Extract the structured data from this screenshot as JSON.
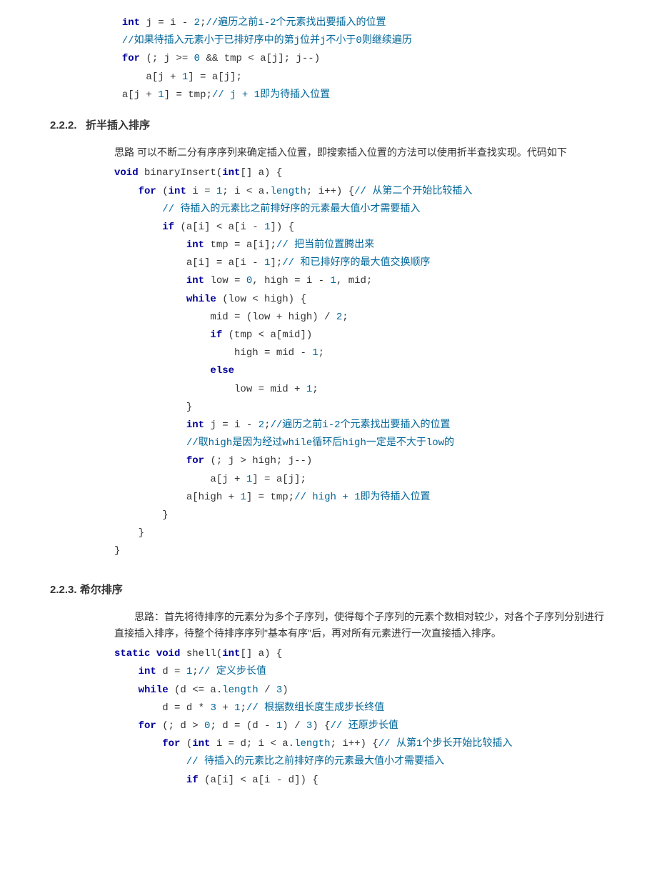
{
  "code_top": {
    "l1": {
      "a": "int",
      "b": " j = i - ",
      "c": "2",
      "d": ";",
      "e": "//遍历之前i-2个元素找出要插入的位置"
    },
    "l2": {
      "a": "//如果待插入元素小于已排好序中的第j位并j不小于0则继续遍历"
    },
    "l3": {
      "a": "for",
      "b": " (; j >= ",
      "c": "0",
      "d": " && tmp < a[j]; j--)"
    },
    "l4": {
      "a": "    a[j + ",
      "b": "1",
      "c": "] = a[j];"
    },
    "l5": {
      "a": "a[j + ",
      "b": "1",
      "c": "] = tmp;",
      "d": "// j + 1即为待插入位置"
    }
  },
  "sec222": {
    "num": "2.2.2.",
    "title": "折半插入排序"
  },
  "intro222": "思路 可以不断二分有序序列来确定插入位置，即搜索插入位置的方法可以使用折半查找实现。代码如下",
  "code222": {
    "l1": {
      "a": "void",
      "b": " binaryInsert(",
      "c": "int",
      "d": "[] a) {"
    },
    "l2": {
      "a": "for",
      "b": " (",
      "c": "int",
      "d": " i = ",
      "e": "1",
      "f": "; i < a.",
      "g": "length",
      "h": "; i++) {",
      "i": "// 从第二个开始比较插入"
    },
    "l3": {
      "a": "// 待插入的元素比之前排好序的元素最大值小才需要插入"
    },
    "l4": {
      "a": "if",
      "b": " (a[i] < a[i - ",
      "c": "1",
      "d": "]) {"
    },
    "l5": {
      "a": "int",
      "b": " tmp = a[i];",
      "c": "// 把当前位置腾出来"
    },
    "l6": {
      "a": "a[i] = a[i - ",
      "b": "1",
      "c": "];",
      "d": "// 和已排好序的最大值交换顺序"
    },
    "l7": {
      "a": "int",
      "b": " low = ",
      "c": "0",
      "d": ", high = i - ",
      "e": "1",
      "f": ", mid;"
    },
    "l8": {
      "a": "while",
      "b": " (low < high) {"
    },
    "l9": {
      "a": "mid = (low + high) / ",
      "b": "2",
      "c": ";"
    },
    "l10": {
      "a": "if",
      "b": " (tmp < a[mid])"
    },
    "l11": {
      "a": "high = mid - ",
      "b": "1",
      "c": ";"
    },
    "l12": {
      "a": "else"
    },
    "l13": {
      "a": "low = mid + ",
      "b": "1",
      "c": ";"
    },
    "l14": {
      "a": "}"
    },
    "l15": {
      "a": "int",
      "b": " j = i - ",
      "c": "2",
      "d": ";",
      "e": "//遍历之前i-2个元素找出要插入的位置"
    },
    "l16": {
      "a": "//取high是因为经过while循环后high一定是不大于low的"
    },
    "l17": {
      "a": "for",
      "b": " (; j > high; j--)"
    },
    "l18": {
      "a": "a[j + ",
      "b": "1",
      "c": "] = a[j];"
    },
    "l19": {
      "a": "a[high + ",
      "b": "1",
      "c": "] = tmp;",
      "d": "// high + 1即为待插入位置"
    },
    "l20": {
      "a": "}"
    },
    "l21": {
      "a": "}"
    },
    "l22": {
      "a": "}"
    }
  },
  "sec223": {
    "num": "2.2.3.",
    "title_a": "希",
    "title_b": "尔排序"
  },
  "intro223": "思路：首先将待排序的元素分为多个子序列，使得每个子序列的元素个数相对较少，对各个子序列分别进行直接插入排序，待整个待排序序列\"基本有序\"后，再对所有元素进行一次直接插入排序。",
  "code223": {
    "l1": {
      "a": "static",
      "b": " ",
      "c": "void",
      "d": " shell(",
      "e": "int",
      "f": "[] a) {"
    },
    "l2": {
      "a": "int",
      "b": " d = ",
      "c": "1",
      "d": ";",
      "e": "// 定义步长值"
    },
    "l3": {
      "a": "while",
      "b": " (d <= a.",
      "c": "length",
      "d": " / ",
      "e": "3",
      "f": ")"
    },
    "l4": {
      "a": "d = d * ",
      "b": "3",
      "c": " + ",
      "d": "1",
      "e": ";",
      "f": "// 根据数组长度生成步长终值"
    },
    "l5": {
      "a": "for",
      "b": " (; d > ",
      "c": "0",
      "d": "; d = (d - ",
      "e": "1",
      "f": ") / ",
      "g": "3",
      "h": ") {",
      "i": "// 还原步长值"
    },
    "l6": {
      "a": "for",
      "b": " (",
      "c": "int",
      "d": " i = d; i < a.",
      "e": "length",
      "f": "; i++) {",
      "g": "// 从第1个步长开始比较插入"
    },
    "l7": {
      "a": "// 待插入的元素比之前排好序的元素最大值小才需要插入"
    },
    "l8": {
      "a": "if",
      "b": " (a[i] < a[i - d]) {"
    }
  }
}
